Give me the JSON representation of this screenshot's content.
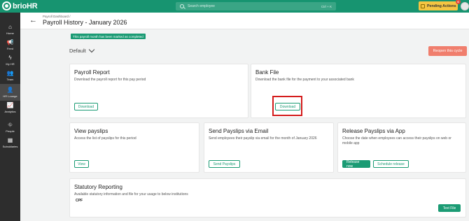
{
  "topbar": {
    "brand_prefix": "brio",
    "brand_suffix": "HR",
    "search_placeholder": "Search employee",
    "search_shortcut": "Ctrl + K",
    "pending_label": "Pending Actions",
    "pending_count": "6"
  },
  "sidebar": {
    "items": [
      {
        "label": "Home",
        "icon": "home-icon",
        "glyph": "⌂"
      },
      {
        "label": "Feed",
        "icon": "megaphone-icon",
        "glyph": "📢"
      },
      {
        "label": "My HR",
        "icon": "bolt-icon",
        "glyph": "ϟ"
      },
      {
        "label": "Team",
        "icon": "team-icon",
        "glyph": "👥"
      },
      {
        "label": "HR Lounge",
        "icon": "lounge-icon",
        "glyph": "👤"
      },
      {
        "label": "Analytics",
        "icon": "analytics-icon",
        "glyph": "📈"
      },
      {
        "label": "People",
        "icon": "org-chart-icon",
        "glyph": "⛗"
      },
      {
        "label": "Subsidiaries",
        "icon": "building-icon",
        "glyph": "▦"
      }
    ]
  },
  "header": {
    "breadcrumb": "Payroll Dashboard /",
    "title": "Payroll History - January 2026"
  },
  "banner": "This payroll month has been marked as completed",
  "selector": {
    "value": "Default"
  },
  "reopen_label": "Reopen this cycle",
  "cards": {
    "payroll_report": {
      "title": "Payroll Report",
      "desc": "Download the payroll report for this pay period",
      "button": "Download"
    },
    "bank_file": {
      "title": "Bank File",
      "desc": "Download the bank file for the payment to your associated bank",
      "button": "Download"
    },
    "view_payslips": {
      "title": "View payslips",
      "desc": "Access the list of payslips for this period",
      "button": "View"
    },
    "send_payslips": {
      "title": "Send Payslips via Email",
      "desc": "Send employees their payslip via email for the month of January 2026",
      "button": "Send Payslips"
    },
    "release_payslips": {
      "title": "Release Payslips via App",
      "desc": "Choose the date when employees can access their payslips on web or mobile app",
      "button_primary": "Release now",
      "button_secondary": "Schedule release"
    },
    "statutory": {
      "title": "Statutory Reporting",
      "desc": "Available statutory information and file for your usage to below institutions",
      "item": "CPF",
      "button": "Text File"
    }
  }
}
